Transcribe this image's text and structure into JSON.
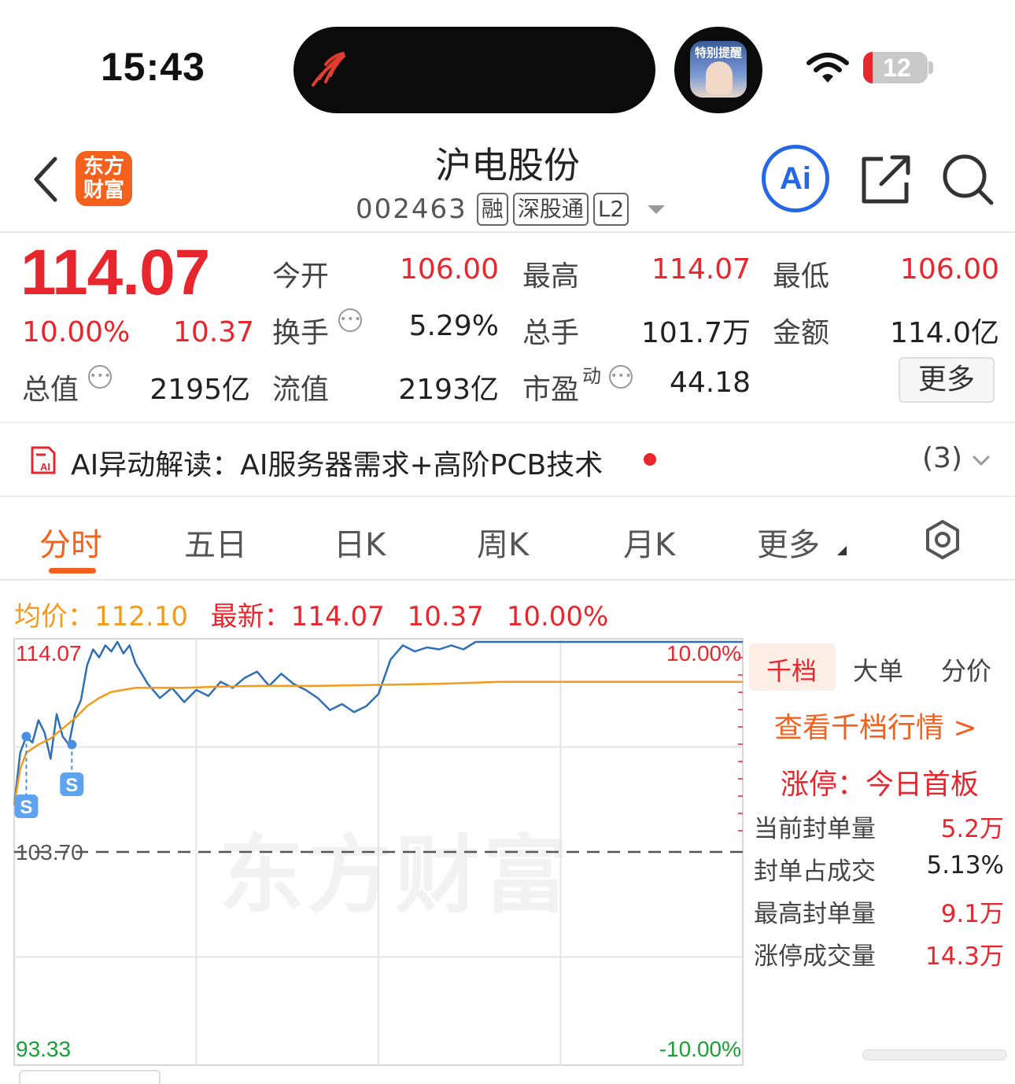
{
  "status": {
    "time": "15:43",
    "notify_label": "特别提醒",
    "battery": "12",
    "battery_low_color": "#e8262d"
  },
  "header": {
    "logo_line1": "东方",
    "logo_line2": "财富",
    "title": "沪电股份",
    "code": "002463",
    "tags": [
      "融",
      "深股通",
      "L2"
    ],
    "ai_button": "Ai"
  },
  "quote": {
    "price": "114.07",
    "change_pct": "10.00%",
    "change": "10.37",
    "stats": [
      {
        "label": "今开",
        "value": "106.00",
        "color": "red"
      },
      {
        "label": "最高",
        "value": "114.07",
        "color": "red"
      },
      {
        "label": "最低",
        "value": "106.00",
        "color": "red"
      },
      {
        "label": "换手",
        "value": "5.29%",
        "color": "normal"
      },
      {
        "label": "总手",
        "value": "101.7万",
        "color": "normal"
      },
      {
        "label": "金额",
        "value": "114.0亿",
        "color": "normal"
      },
      {
        "label": "总值",
        "value": "2195亿",
        "color": "normal"
      },
      {
        "label": "流值",
        "value": "2193亿",
        "color": "normal"
      },
      {
        "label": "市盈",
        "label_sup": "动",
        "value": "44.18",
        "color": "normal"
      }
    ],
    "more_button": "更多"
  },
  "ai_bar": {
    "text": "AI异动解读：AI服务器需求+高阶PCB技术",
    "count": "(3)"
  },
  "tabs": [
    "分时",
    "五日",
    "日K",
    "周K",
    "月K",
    "更多"
  ],
  "chart_header": {
    "avg_label": "均价：",
    "avg_value": "112.10",
    "latest_label": "最新：",
    "latest_value": "114.07",
    "latest_change": "10.37",
    "latest_pct": "10.00%"
  },
  "right_panel": {
    "tabs": [
      "千档",
      "大单",
      "分价"
    ],
    "link": "查看千档行情 >",
    "limit_label": "涨停：今日首板",
    "rows": [
      {
        "label": "当前封单量",
        "value": "5.2万",
        "color": "red"
      },
      {
        "label": "封单占成交",
        "value": "5.13%",
        "color": "normal"
      },
      {
        "label": "最高封单量",
        "value": "9.1万",
        "color": "red"
      },
      {
        "label": "涨停成交量",
        "value": "14.3万",
        "color": "red"
      }
    ]
  },
  "watermark": "东方财富",
  "chart_data": {
    "type": "line",
    "y_labels": {
      "top": "114.07",
      "mid": "103.70",
      "bottom": "93.33"
    },
    "pct_labels": {
      "top": "10.00%",
      "bottom": "-10.00%"
    },
    "ylim": [
      93.33,
      114.07
    ],
    "reference": 103.7,
    "x_range": [
      0,
      240
    ],
    "series": [
      {
        "color": "#2f6fb5",
        "x": [
          0,
          2,
          4,
          6,
          8,
          10,
          12,
          14,
          16,
          18,
          20,
          22,
          24,
          26,
          28,
          30,
          32,
          34,
          36,
          38,
          40,
          44,
          48,
          52,
          56,
          60,
          64,
          68,
          72,
          76,
          80,
          84,
          88,
          92,
          96,
          100,
          104,
          108,
          112,
          116,
          120,
          124,
          128,
          132,
          136,
          140,
          144,
          148,
          152,
          156,
          160,
          166,
          172,
          180,
          190,
          200,
          210,
          220,
          230,
          240
        ],
        "values": [
          106.0,
          108.6,
          109.4,
          109.1,
          110.2,
          109.6,
          108.3,
          110.5,
          109.4,
          109.0,
          110.5,
          111.2,
          112.9,
          113.7,
          113.3,
          113.9,
          113.6,
          114.07,
          113.5,
          113.9,
          113.0,
          112.0,
          111.3,
          111.8,
          111.1,
          111.7,
          111.4,
          112.1,
          111.8,
          112.3,
          112.6,
          111.9,
          112.5,
          112.0,
          111.7,
          111.3,
          110.7,
          111.0,
          110.6,
          110.9,
          111.5,
          113.2,
          113.9,
          113.6,
          113.8,
          113.7,
          113.9,
          113.7,
          114.07,
          114.07,
          114.07,
          114.07,
          114.07,
          114.07,
          114.07,
          114.07,
          114.07,
          114.07,
          114.07,
          114.07
        ]
      },
      {
        "color": "#f39b1c",
        "x": [
          0,
          2,
          4,
          8,
          12,
          16,
          20,
          24,
          28,
          32,
          36,
          40,
          48,
          56,
          64,
          80,
          100,
          120,
          140,
          150,
          160,
          180,
          200,
          220,
          240
        ],
        "values": [
          106.0,
          107.8,
          108.6,
          109.0,
          109.3,
          109.8,
          110.3,
          110.9,
          111.3,
          111.6,
          111.7,
          111.8,
          111.8,
          111.8,
          111.85,
          111.9,
          111.9,
          111.95,
          112.0,
          112.05,
          112.1,
          112.1,
          112.1,
          112.1,
          112.1
        ]
      }
    ],
    "markers": [
      {
        "x": 4,
        "label": "S"
      },
      {
        "x": 19,
        "label": "S"
      }
    ]
  }
}
